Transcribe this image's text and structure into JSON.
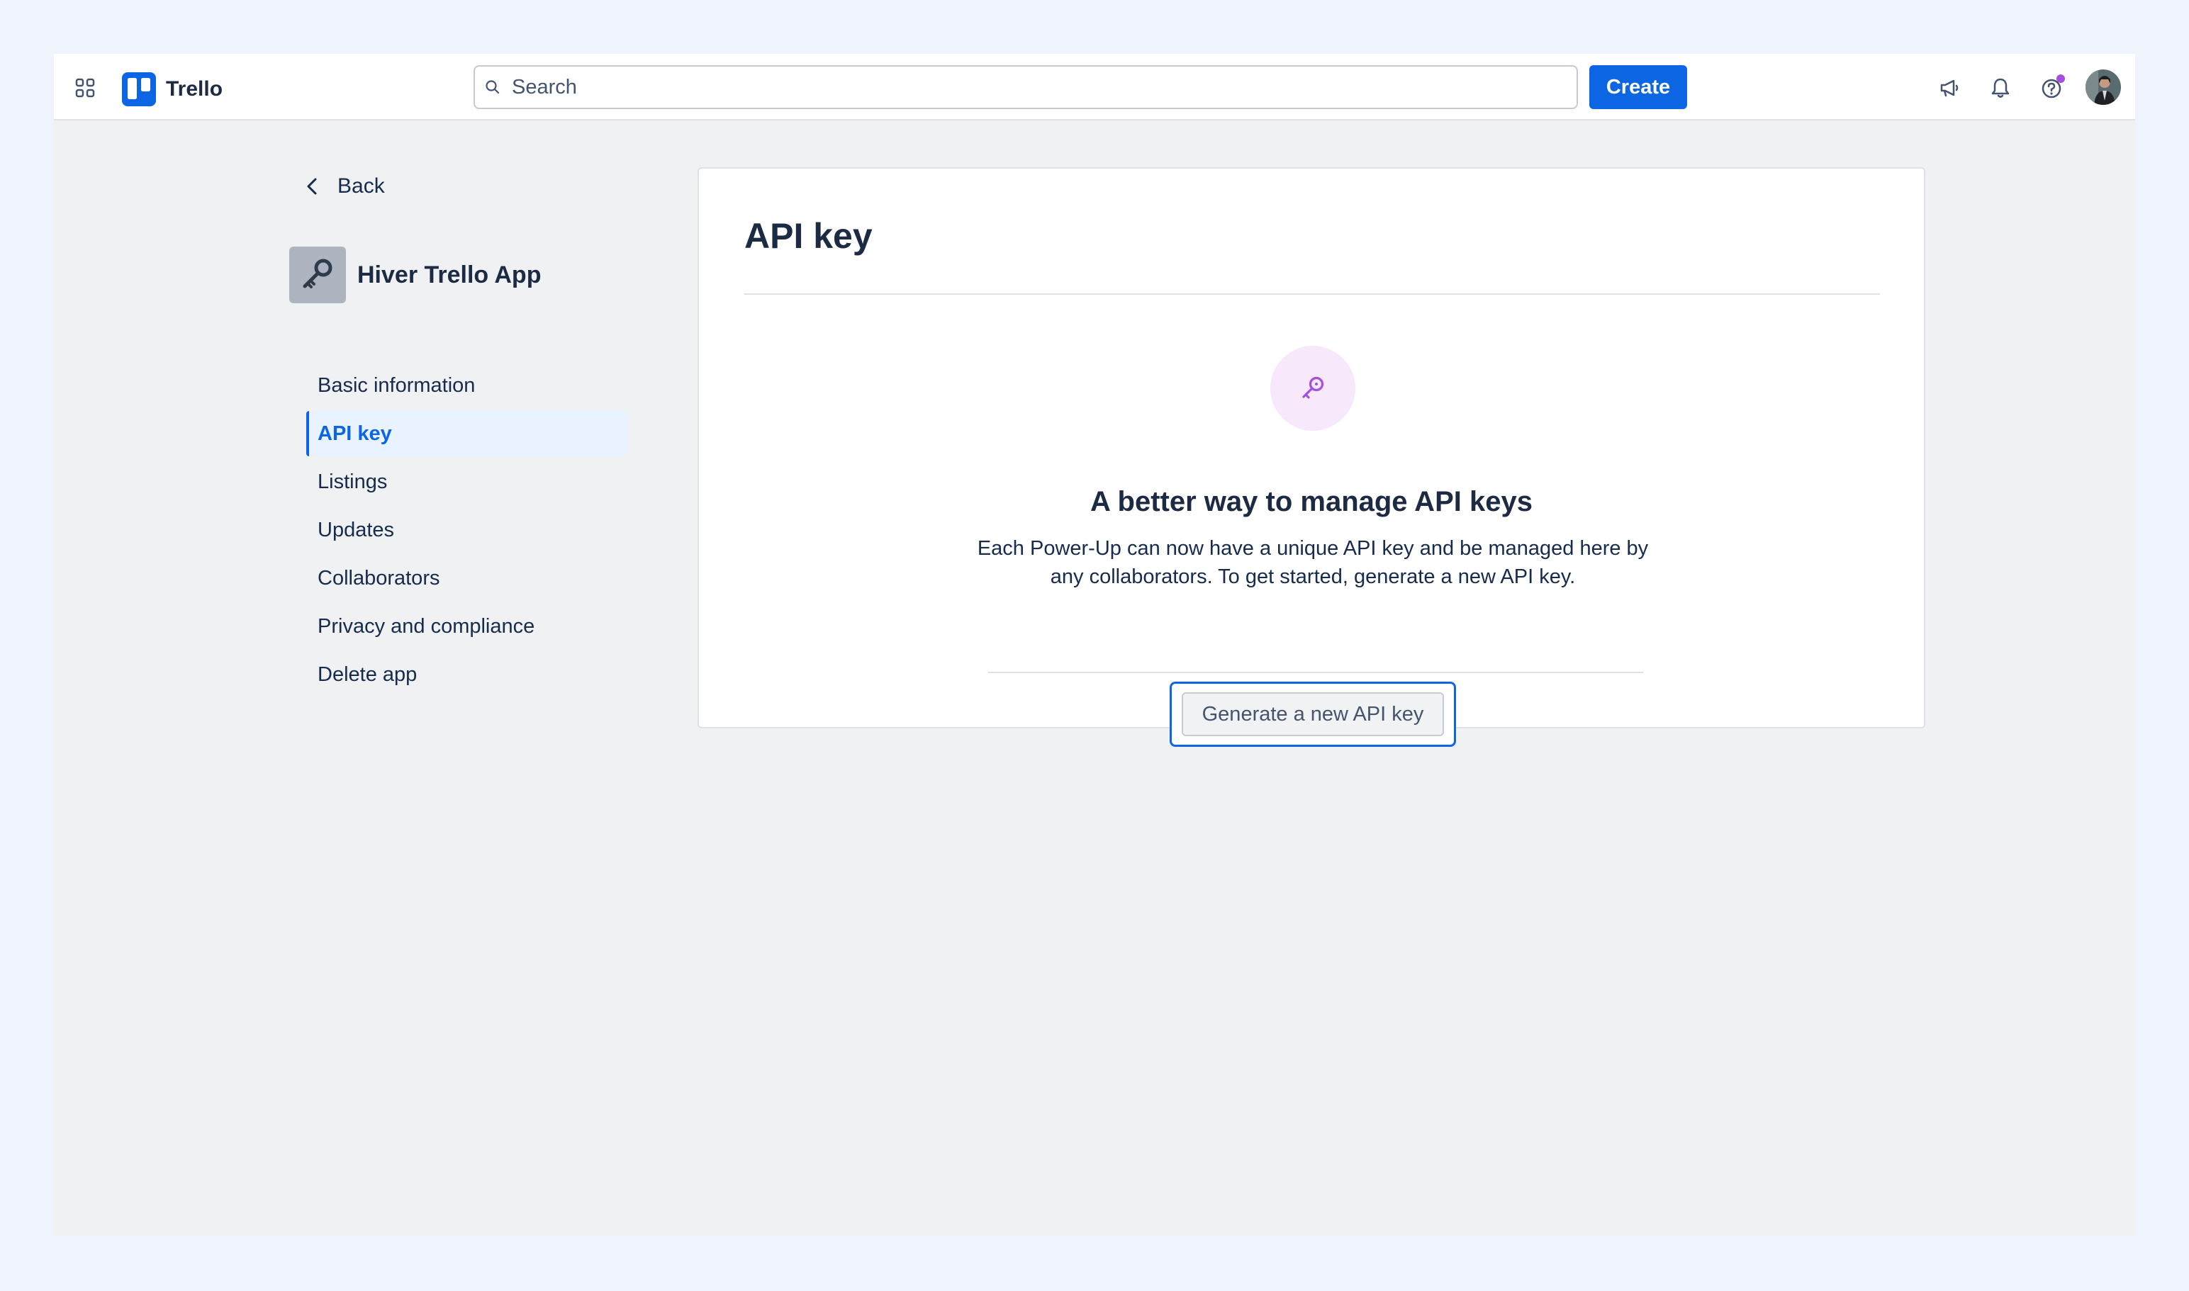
{
  "header": {
    "brand": "Trello",
    "search": {
      "placeholder": "Search",
      "value": ""
    },
    "create_label": "Create",
    "icons": [
      "apps-grid-icon",
      "trello-logo-icon",
      "search-icon",
      "megaphone-icon",
      "bell-icon",
      "help-icon",
      "avatar"
    ],
    "help_badge_color": "#a54ee1"
  },
  "sidebar": {
    "back_label": "Back",
    "app_name": "Hiver Trello App",
    "items": [
      {
        "label": "Basic information",
        "active": false
      },
      {
        "label": "API key",
        "active": true
      },
      {
        "label": "Listings",
        "active": false
      },
      {
        "label": "Updates",
        "active": false
      },
      {
        "label": "Collaborators",
        "active": false
      },
      {
        "label": "Privacy and compliance",
        "active": false
      },
      {
        "label": "Delete app",
        "active": false
      }
    ]
  },
  "main": {
    "title": "API key",
    "promo": {
      "heading": "A better way to manage API keys",
      "text": "Each Power-Up can now have a unique API key and be managed here by any collaborators. To get started, generate a new API key.",
      "button_label": "Generate a new API key"
    }
  },
  "colors": {
    "accent": "#0c66e4",
    "key_icon": "#a54ee1",
    "key_circle_bg": "#f8e8fc"
  }
}
